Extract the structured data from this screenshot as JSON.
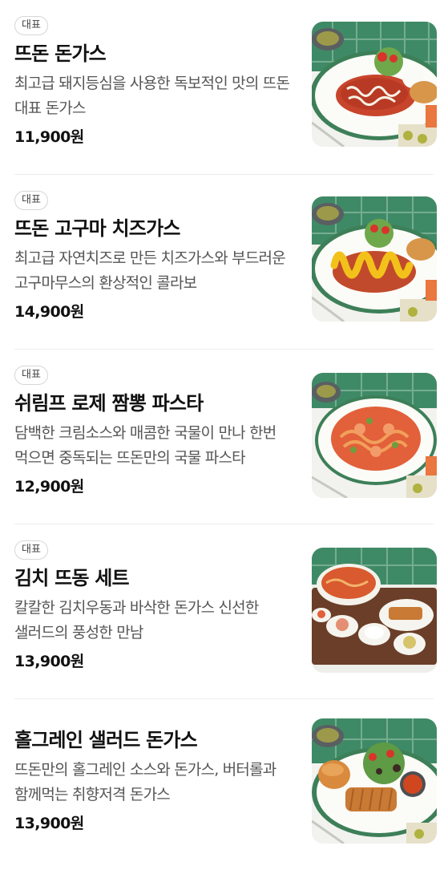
{
  "menu": {
    "items": [
      {
        "badge": "대표",
        "name": "뜨돈 돈가스",
        "description": "최고급 돼지등심을 사용한 독보적인 맛의 뜨돈 대표 돈가스",
        "price": "11,900원",
        "image": "tonkatsu-plate-photo"
      },
      {
        "badge": "대표",
        "name": "뜨돈 고구마 치즈가스",
        "description": "최고급 자연치즈로 만든 치즈가스와 부드러운 고구마무스의 환상적인 콜라보",
        "price": "14,900원",
        "image": "sweet-potato-cheese-katsu-photo"
      },
      {
        "badge": "대표",
        "name": "쉬림프 로제 짬뽕 파스타",
        "description": "담백한 크림소스와 매콤한 국물이 만나 한번 먹으면 중독되는 뜨돈만의 국물 파스타",
        "price": "12,900원",
        "image": "shrimp-rose-pasta-photo"
      },
      {
        "badge": "대표",
        "name": "김치 뜨동 세트",
        "description": "칼칼한 김치우동과 바삭한 돈가스 신선한 샐러드의 풍성한 만남",
        "price": "13,900원",
        "image": "kimchi-udon-set-photo"
      },
      {
        "name": "홀그레인 샐러드 돈가스",
        "description": "뜨돈만의 홀그레인 소스와 돈가스, 버터롤과 함께먹는 취향저격 돈가스",
        "price": "13,900원",
        "image": "whole-grain-salad-katsu-photo"
      }
    ]
  },
  "colors": {
    "tile_green": "#3f8a66",
    "plate_rim": "#3d7f58",
    "sauce_red": "#c8452c",
    "cutlet_brown": "#c97a35",
    "cheese_yellow": "#f2c21b"
  }
}
